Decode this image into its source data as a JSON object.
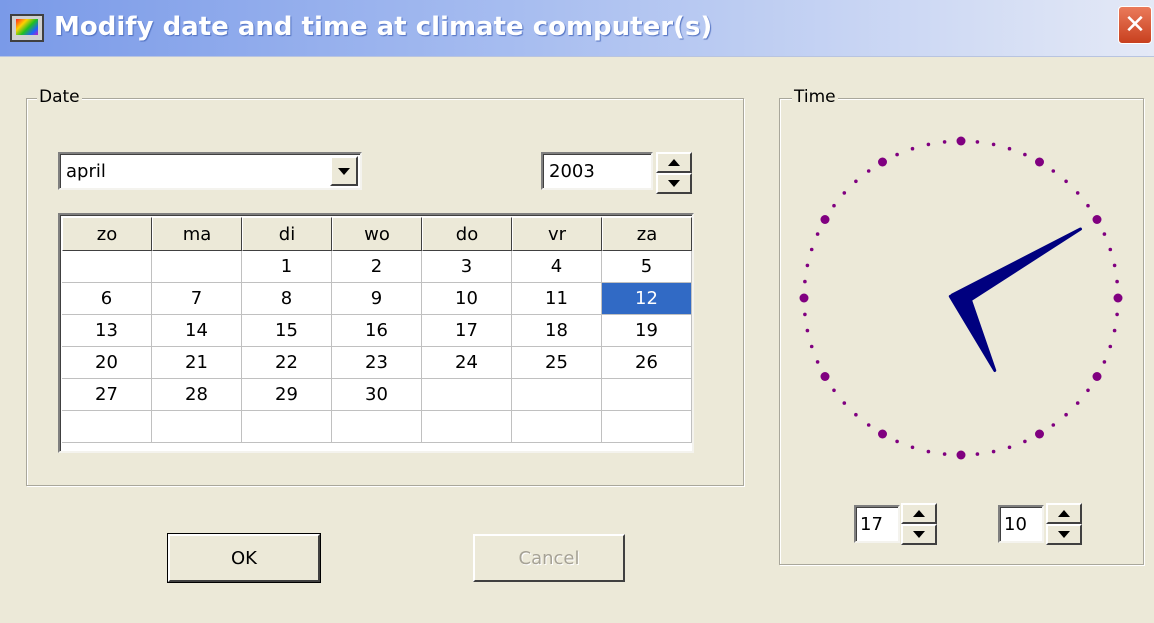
{
  "window": {
    "title": "Modify date and time at climate computer(s)",
    "close_label": "✕"
  },
  "date_group": {
    "label": "Date",
    "month": "april",
    "year": "2003",
    "weekdays": [
      "zo",
      "ma",
      "di",
      "wo",
      "do",
      "vr",
      "za"
    ],
    "weeks": [
      [
        "",
        "",
        "1",
        "2",
        "3",
        "4",
        "5"
      ],
      [
        "6",
        "7",
        "8",
        "9",
        "10",
        "11",
        "12"
      ],
      [
        "13",
        "14",
        "15",
        "16",
        "17",
        "18",
        "19"
      ],
      [
        "20",
        "21",
        "22",
        "23",
        "24",
        "25",
        "26"
      ],
      [
        "27",
        "28",
        "29",
        "30",
        "",
        "",
        ""
      ],
      [
        "",
        "",
        "",
        "",
        "",
        "",
        ""
      ]
    ],
    "selected_day": "12"
  },
  "time_group": {
    "label": "Time",
    "hour": "17",
    "minute": "10"
  },
  "buttons": {
    "ok_label": "OK",
    "cancel_label": "Cancel"
  },
  "colors": {
    "clock_hands": "#00007f",
    "clock_dots": "#800080",
    "selection": "#316ac5"
  }
}
